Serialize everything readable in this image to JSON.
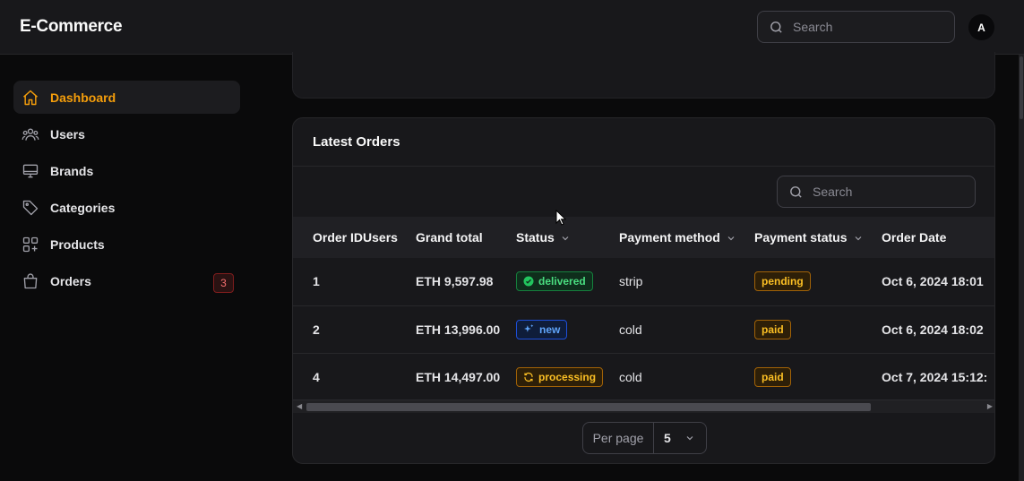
{
  "app": {
    "title": "E-Commerce"
  },
  "header": {
    "search_placeholder": "Search",
    "avatar_initial": "A"
  },
  "sidebar": {
    "items": [
      {
        "label": "Dashboard",
        "icon": "home-icon",
        "active": true
      },
      {
        "label": "Users",
        "icon": "users-icon"
      },
      {
        "label": "Brands",
        "icon": "monitor-icon"
      },
      {
        "label": "Categories",
        "icon": "tag-icon"
      },
      {
        "label": "Products",
        "icon": "grid-plus-icon"
      },
      {
        "label": "Orders",
        "icon": "shopping-bag-icon",
        "badge": "3"
      }
    ]
  },
  "orders": {
    "title": "Latest Orders",
    "search_placeholder": "Search",
    "columns": [
      "Order ID",
      "Users",
      "Grand total",
      "Status",
      "Payment method",
      "Payment status",
      "Order Date"
    ],
    "rows": [
      {
        "id": "1",
        "user": "",
        "total": "ETH 9,597.98",
        "status": "delivered",
        "method": "strip",
        "payment": "pending",
        "date": "Oct 6, 2024 18:01"
      },
      {
        "id": "2",
        "user": "",
        "total": "ETH 13,996.00",
        "status": "new",
        "method": "cold",
        "payment": "paid",
        "date": "Oct 6, 2024 18:02"
      },
      {
        "id": "4",
        "user": "",
        "total": "ETH 14,497.00",
        "status": "processing",
        "method": "cold",
        "payment": "paid",
        "date": "Oct 7, 2024 15:12:"
      }
    ],
    "pagination": {
      "per_page_label": "Per page",
      "per_page_value": "5"
    }
  },
  "colors": {
    "accent": "#f59e0b",
    "background": "#0a0a0b",
    "surface": "#18181b",
    "danger": "#f87171"
  }
}
